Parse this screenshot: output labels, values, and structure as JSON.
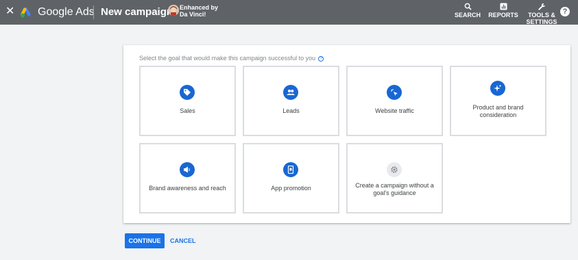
{
  "header": {
    "close_icon": "close-icon",
    "logo": "google-ads-logo",
    "brand": "Google Ads",
    "title": "New campaign",
    "account_label": "Enhanced by Da Vinci!",
    "nav": [
      {
        "label": "SEARCH",
        "icon": "search-icon"
      },
      {
        "label": "REPORTS",
        "icon": "reports-icon"
      },
      {
        "label": "TOOLS & SETTINGS",
        "icon": "wrench-icon"
      }
    ],
    "help_icon": "help-icon",
    "help_glyph": "?",
    "bg_color": "#5f6368"
  },
  "panel": {
    "prompt": "Select the goal that would make this campaign successful to you",
    "prompt_help_glyph": "?",
    "goals": [
      {
        "label": "Sales",
        "icon": "tag-icon"
      },
      {
        "label": "Leads",
        "icon": "people-icon"
      },
      {
        "label": "Website traffic",
        "icon": "cursor-click-icon"
      },
      {
        "label": "Product and brand consideration",
        "icon": "sparkle-icon"
      },
      {
        "label": "Brand awareness and reach",
        "icon": "megaphone-icon"
      },
      {
        "label": "App promotion",
        "icon": "phone-icon"
      },
      {
        "label": "Create a campaign without a goal's guidance",
        "icon": "gear-icon"
      }
    ]
  },
  "actions": {
    "continue": "CONTINUE",
    "cancel": "CANCEL",
    "accent": "#1a73e8"
  }
}
